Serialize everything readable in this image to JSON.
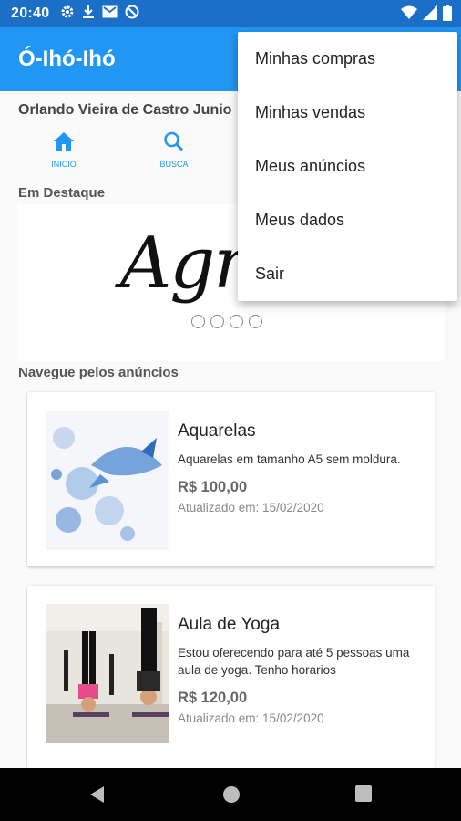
{
  "status_bar": {
    "time": "20:40"
  },
  "app": {
    "title": "Ó-Ihó-Ihó"
  },
  "user": {
    "name": "Orlando Vieira de Castro Junio"
  },
  "tabs": [
    {
      "label": "INICIO",
      "icon": "home-icon"
    },
    {
      "label": "BUSCA",
      "icon": "search-icon"
    }
  ],
  "featured": {
    "title": "Em Destaque",
    "banner_text": "Agra",
    "dots": 4
  },
  "browse": {
    "title": "Navegue pelos anúncios"
  },
  "listings": [
    {
      "title": "Aquarelas",
      "description": "Aquarelas em tamanho A5 sem moldura.",
      "price": "R$ 100,00",
      "updated": "Atualizado em: 15/02/2020"
    },
    {
      "title": "Aula de Yoga",
      "description": "Estou oferecendo para até 5 pessoas uma aula de yoga. Tenho horarios",
      "price": "R$ 120,00",
      "updated": "Atualizado em: 15/02/2020"
    }
  ],
  "menu": {
    "items": [
      "Minhas compras",
      "Minhas vendas",
      "Meus anúncios",
      "Meus dados",
      "Sair"
    ]
  },
  "colors": {
    "primary": "#2196f3",
    "status_bar": "#1b6fc7"
  }
}
